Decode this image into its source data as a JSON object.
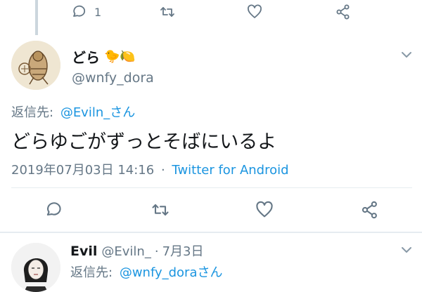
{
  "prev_tweet": {
    "reply_count": "1"
  },
  "main_tweet": {
    "display_name": "どら",
    "emojis": "🐤🍋",
    "handle": "@wnfy_dora",
    "reply_prefix": "返信先:",
    "reply_to": "@Eviln_さん",
    "text": "どらゆごがずっとそばにいるよ",
    "timestamp": "2019年07月03日 14:16",
    "separator": "·",
    "source": "Twitter for Android"
  },
  "next_tweet": {
    "display_name": "Evil",
    "handle": "@Eviln_",
    "separator": "·",
    "date": "7月3日",
    "reply_prefix": "返信先:",
    "reply_to": "@wnfy_dora",
    "reply_suffix": "さん"
  },
  "colors": {
    "link": "#1b95e0",
    "muted": "#657786",
    "divider": "#e6ecf0"
  },
  "icons": [
    "reply-icon",
    "retweet-icon",
    "like-icon",
    "share-icon",
    "chevron-down-icon"
  ]
}
